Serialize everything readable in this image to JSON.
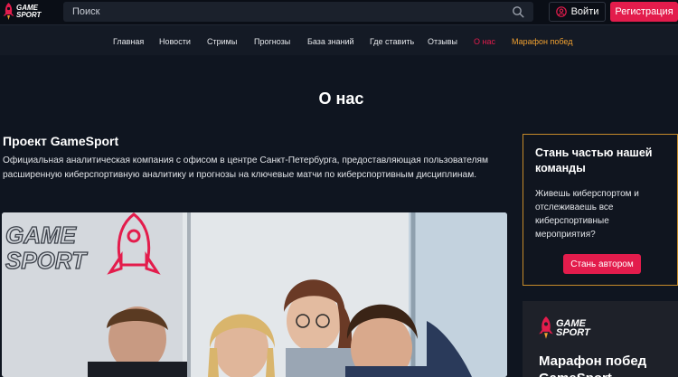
{
  "header": {
    "logo_line1": "GAME",
    "logo_line2": "SPORT",
    "search_placeholder": "Поиск",
    "login_label": "Войти",
    "register_label": "Регистрация"
  },
  "nav": {
    "items": [
      {
        "label": "Главная"
      },
      {
        "label": "Новости"
      },
      {
        "label": "Стримы"
      },
      {
        "label": "Прогнозы"
      },
      {
        "label": "База знаний"
      },
      {
        "label": "Где ставить"
      },
      {
        "label": "Отзывы"
      },
      {
        "label": "О нас",
        "active": true
      },
      {
        "label": "Марафон побед",
        "highlight": true
      }
    ]
  },
  "main": {
    "page_title": "О нас",
    "section_title": "Проект GameSport",
    "section_text": "Официальная аналитическая компания с офисом в центре Санкт-Петербурга, предоставляющая пользователям расширенную киберспортивную аналитику и прогнозы на ключевые матчи по киберспортивным дисциплинам.",
    "photo_wall_text1": "GAME",
    "photo_wall_text2": "SPORT"
  },
  "sidebar": {
    "card1": {
      "title": "Стань частью нашей команды",
      "text": "Живешь киберспортом и отслеживаешь все киберспортивные мероприятия?",
      "button_label": "Стань автором"
    },
    "card2": {
      "logo_line1": "GAME",
      "logo_line2": "SPORT",
      "title": "Марафон побед GameSport"
    }
  },
  "colors": {
    "accent": "#e31c4c",
    "gold": "#f0a030",
    "background": "#0f1520"
  }
}
